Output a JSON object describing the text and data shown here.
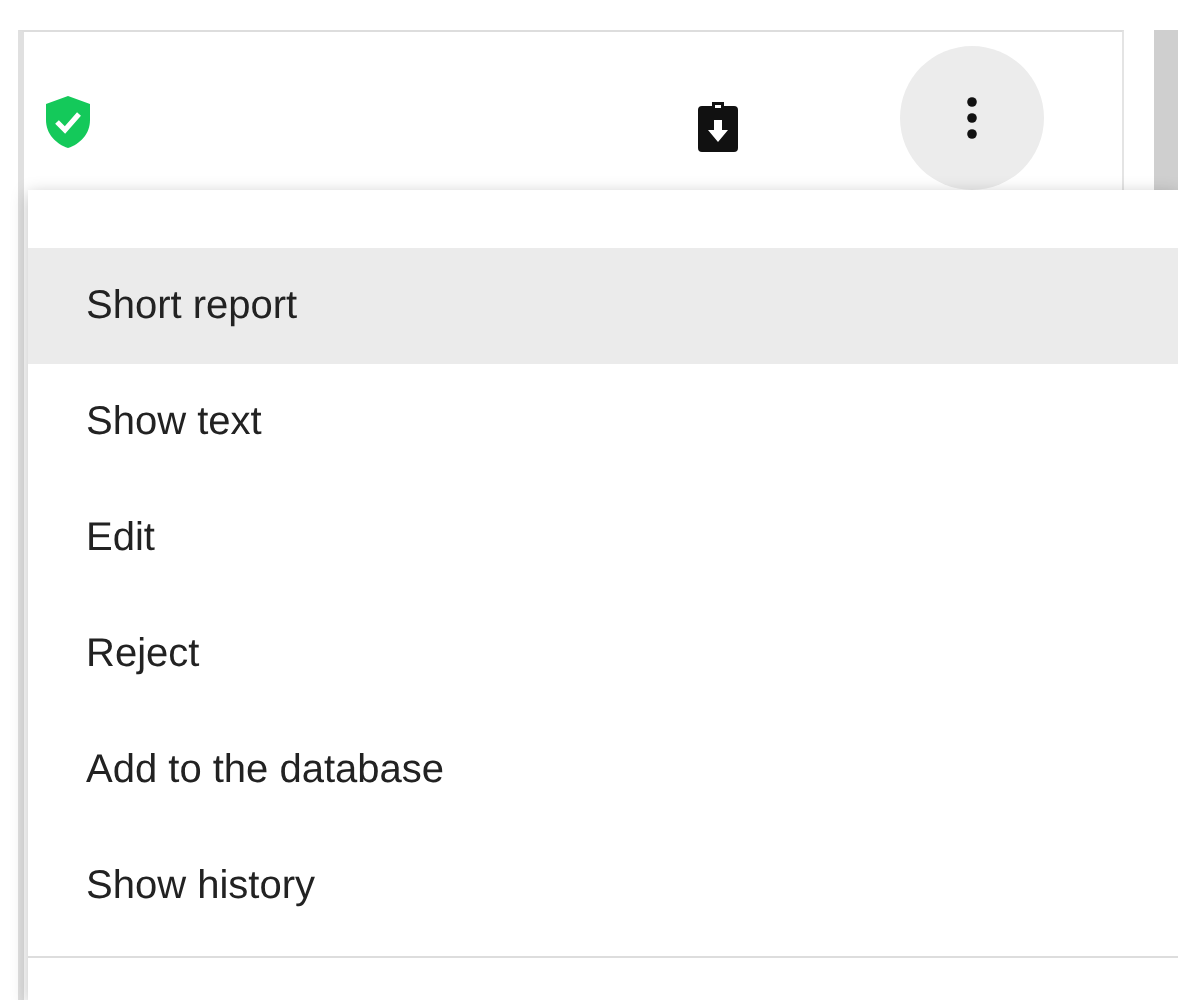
{
  "menu": {
    "items": [
      {
        "label": "Short report",
        "selected": true
      },
      {
        "label": "Show text",
        "selected": false
      },
      {
        "label": "Edit",
        "selected": false
      },
      {
        "label": "Reject",
        "selected": false
      },
      {
        "label": "Add to the database",
        "selected": false
      },
      {
        "label": "Show history",
        "selected": false
      }
    ]
  }
}
